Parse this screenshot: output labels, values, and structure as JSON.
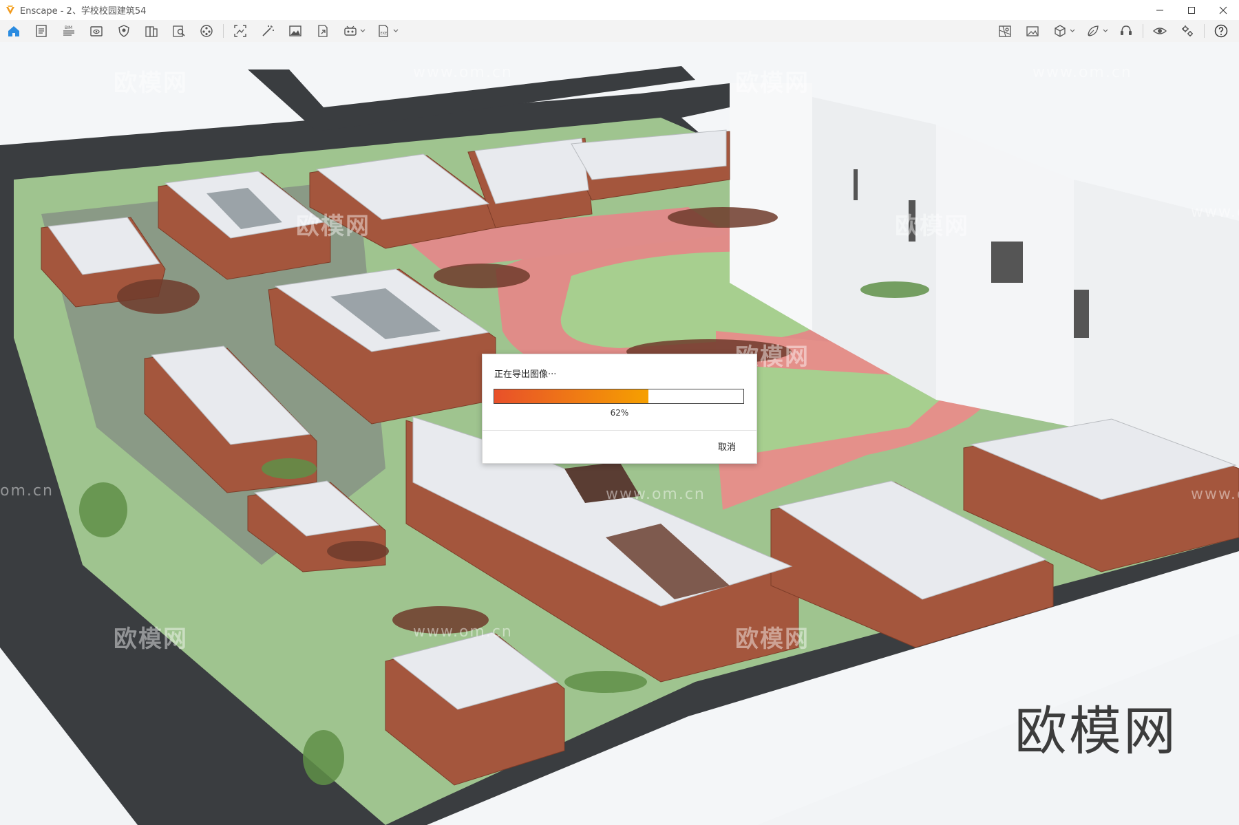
{
  "window": {
    "title": "Enscape - 2、学校校园建筑54",
    "minimize_icon": "minimize-icon",
    "maximize_icon": "maximize-icon",
    "close_icon": "close-icon"
  },
  "toolbar": {
    "left_icons": [
      "home-icon",
      "notes-icon",
      "bim-icon",
      "view-icon",
      "shield-icon",
      "library-icon",
      "asset-search-icon",
      "reel-icon",
      "screenshot-icon",
      "magic-wand-icon",
      "image-icon",
      "export-icon",
      "vr-icon",
      "batch-export-icon"
    ],
    "right_icons": [
      "map-icon",
      "gallery-icon",
      "cube-icon",
      "material-icon",
      "headset-icon",
      "eye-icon",
      "settings-icon",
      "help-icon"
    ]
  },
  "viewport": {
    "watermarks": [
      "欧模网",
      "www.om.cn",
      "欧模网",
      "www.om.cn",
      "欧模网",
      "欧模网",
      "欧模网",
      "欧模网",
      "欧模网",
      "om.cn",
      "www.om.cn",
      "www.om.cn",
      "www.om.cn",
      "www.om.cn"
    ],
    "brand_watermark": "欧模网"
  },
  "dialog": {
    "title": "正在导出图像···",
    "progress_percent_label": "62%",
    "progress": 0.62,
    "cancel_label": "取消",
    "colors": {
      "fill_start": "#e8502a",
      "fill_end": "#f6a000"
    }
  }
}
